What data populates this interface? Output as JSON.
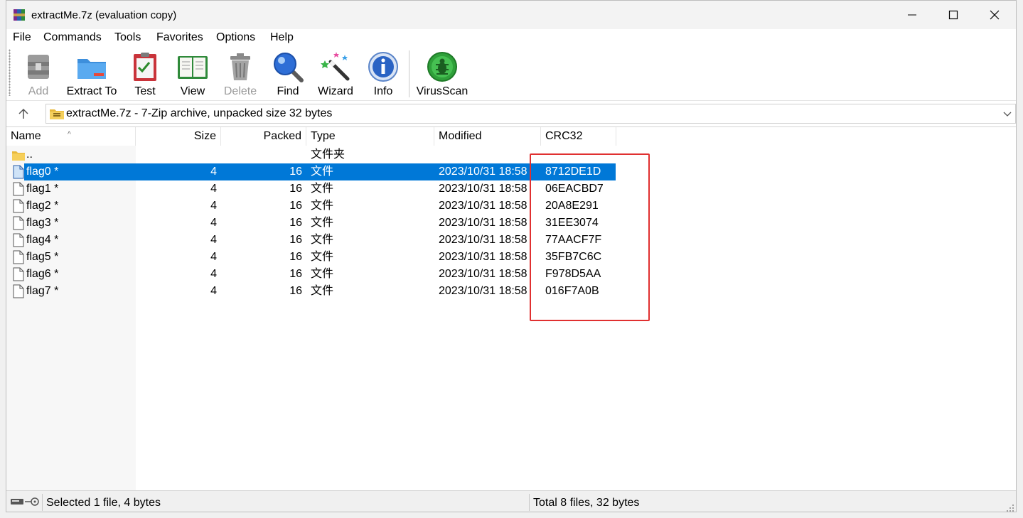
{
  "window": {
    "title": "extractMe.7z (evaluation copy)"
  },
  "menu": [
    {
      "label": "File"
    },
    {
      "label": "Commands"
    },
    {
      "label": "Tools"
    },
    {
      "label": "Favorites"
    },
    {
      "label": "Options"
    },
    {
      "label": "Help"
    }
  ],
  "toolbar": [
    {
      "label": "Add",
      "icon": "archive-add-icon",
      "enabled": false
    },
    {
      "label": "Extract To",
      "icon": "folder-extract-icon",
      "enabled": true
    },
    {
      "label": "Test",
      "icon": "test-clipboard-icon",
      "enabled": true
    },
    {
      "label": "View",
      "icon": "book-view-icon",
      "enabled": true
    },
    {
      "label": "Delete",
      "icon": "trash-icon",
      "enabled": false
    },
    {
      "label": "Find",
      "icon": "magnifier-icon",
      "enabled": true
    },
    {
      "label": "Wizard",
      "icon": "magic-wand-icon",
      "enabled": true
    },
    {
      "label": "Info",
      "icon": "info-icon",
      "enabled": true
    },
    {
      "label": "VirusScan",
      "icon": "virus-scan-icon",
      "enabled": true
    }
  ],
  "address": {
    "text": "extractMe.7z - 7-Zip archive, unpacked size 32 bytes"
  },
  "columns": {
    "name": "Name",
    "size": "Size",
    "packed": "Packed",
    "type": "Type",
    "modified": "Modified",
    "crc": "CRC32"
  },
  "parent_row": {
    "name": "..",
    "type": "文件夹"
  },
  "files": [
    {
      "name": "flag0 *",
      "size": "4",
      "packed": "16",
      "type": "文件",
      "modified": "2023/10/31 18:58",
      "crc": "8712DE1D",
      "selected": true
    },
    {
      "name": "flag1 *",
      "size": "4",
      "packed": "16",
      "type": "文件",
      "modified": "2023/10/31 18:58",
      "crc": "06EACBD7",
      "selected": false
    },
    {
      "name": "flag2 *",
      "size": "4",
      "packed": "16",
      "type": "文件",
      "modified": "2023/10/31 18:58",
      "crc": "20A8E291",
      "selected": false
    },
    {
      "name": "flag3 *",
      "size": "4",
      "packed": "16",
      "type": "文件",
      "modified": "2023/10/31 18:58",
      "crc": "31EE3074",
      "selected": false
    },
    {
      "name": "flag4 *",
      "size": "4",
      "packed": "16",
      "type": "文件",
      "modified": "2023/10/31 18:58",
      "crc": "77AACF7F",
      "selected": false
    },
    {
      "name": "flag5 *",
      "size": "4",
      "packed": "16",
      "type": "文件",
      "modified": "2023/10/31 18:58",
      "crc": "35FB7C6C",
      "selected": false
    },
    {
      "name": "flag6 *",
      "size": "4",
      "packed": "16",
      "type": "文件",
      "modified": "2023/10/31 18:58",
      "crc": "F978D5AA",
      "selected": false
    },
    {
      "name": "flag7 *",
      "size": "4",
      "packed": "16",
      "type": "文件",
      "modified": "2023/10/31 18:58",
      "crc": "016F7A0B",
      "selected": false
    }
  ],
  "status": {
    "left": "Selected 1 file, 4 bytes",
    "right": "Total 8 files, 32 bytes"
  },
  "colors": {
    "selection": "#0078d7",
    "annotation_box": "#e03030"
  }
}
